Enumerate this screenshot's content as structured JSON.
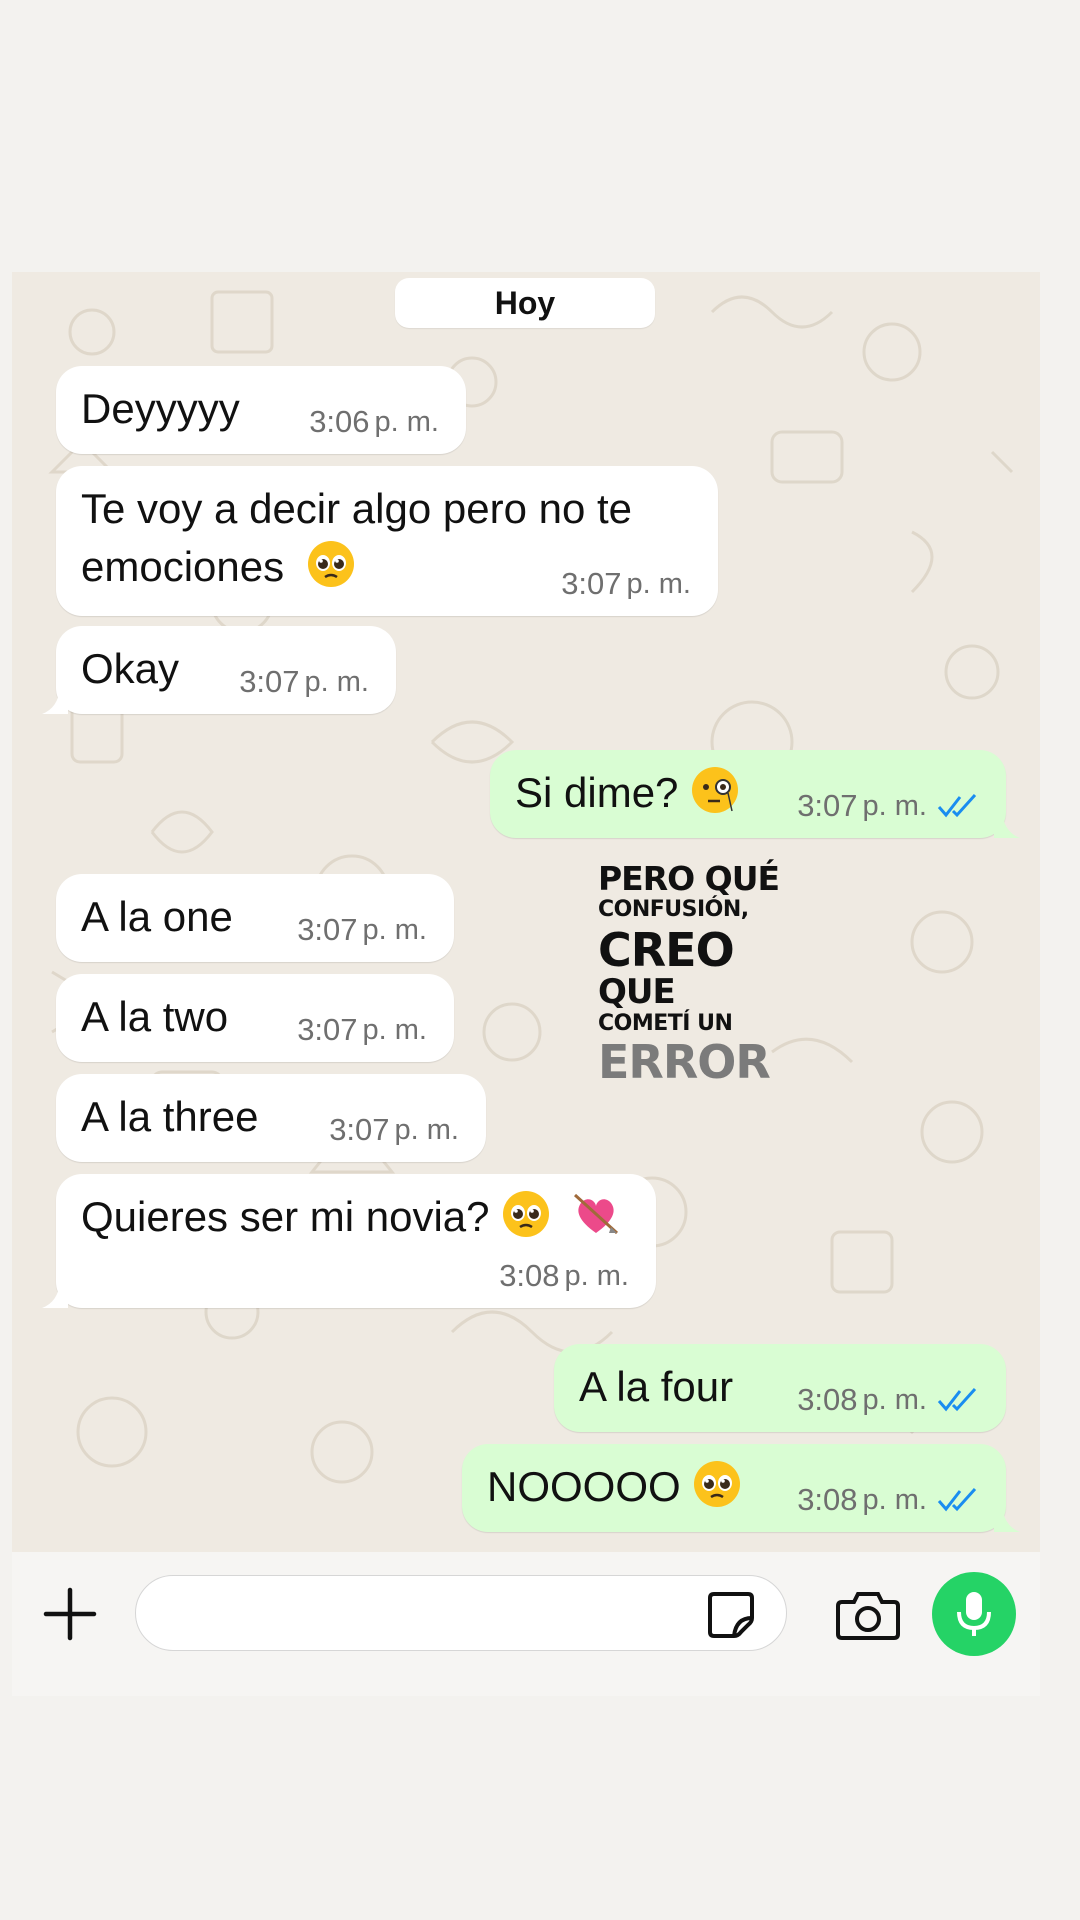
{
  "date_chip": "Hoy",
  "colors": {
    "incoming_bubble": "#ffffff",
    "outgoing_bubble": "#d9fdd3",
    "read_ticks": "#1a8df0",
    "mic_button": "#25d366",
    "chat_background": "#efeae2"
  },
  "messages": [
    {
      "direction": "in",
      "text": "Deyyyyy",
      "time": "3:06",
      "ampm": "p. m."
    },
    {
      "direction": "in",
      "text_line1": "Te voy a decir algo pero no te",
      "text_line2": "emociones",
      "emoji": "pleading-face",
      "time": "3:07",
      "ampm": "p. m."
    },
    {
      "direction": "in",
      "text": "Okay",
      "time": "3:07",
      "ampm": "p. m."
    },
    {
      "direction": "out",
      "text": "Si dime?",
      "emoji": "face-with-monocle",
      "time": "3:07",
      "ampm": "p. m.",
      "status": "read"
    },
    {
      "direction": "in",
      "text": "A la one",
      "time": "3:07",
      "ampm": "p. m."
    },
    {
      "direction": "in",
      "text": "A la two",
      "time": "3:07",
      "ampm": "p. m."
    },
    {
      "direction": "in",
      "text": "A la three",
      "time": "3:07",
      "ampm": "p. m."
    },
    {
      "direction": "in",
      "text": "Quieres ser mi novia?",
      "emojis": [
        "pleading-face",
        "heart-with-arrow"
      ],
      "time": "3:08",
      "ampm": "p. m."
    },
    {
      "direction": "out",
      "text": "A la four",
      "time": "3:08",
      "ampm": "p. m.",
      "status": "read"
    },
    {
      "direction": "out",
      "text": "NOOOOO",
      "emoji": "pleading-face",
      "time": "3:08",
      "ampm": "p. m.",
      "status": "read"
    }
  ],
  "sticker": {
    "line1": "PERO QUÉ",
    "line2": "CONFUSIÓN,",
    "line3": "CREO",
    "line4": "QUE",
    "line5": "COMETÍ UN",
    "line6": "ERROR"
  },
  "input_bar": {
    "left_icon": "plus-icon",
    "field_icon": "sticker-icon",
    "camera_icon": "camera-icon",
    "mic_icon": "microphone-icon",
    "placeholder": ""
  }
}
